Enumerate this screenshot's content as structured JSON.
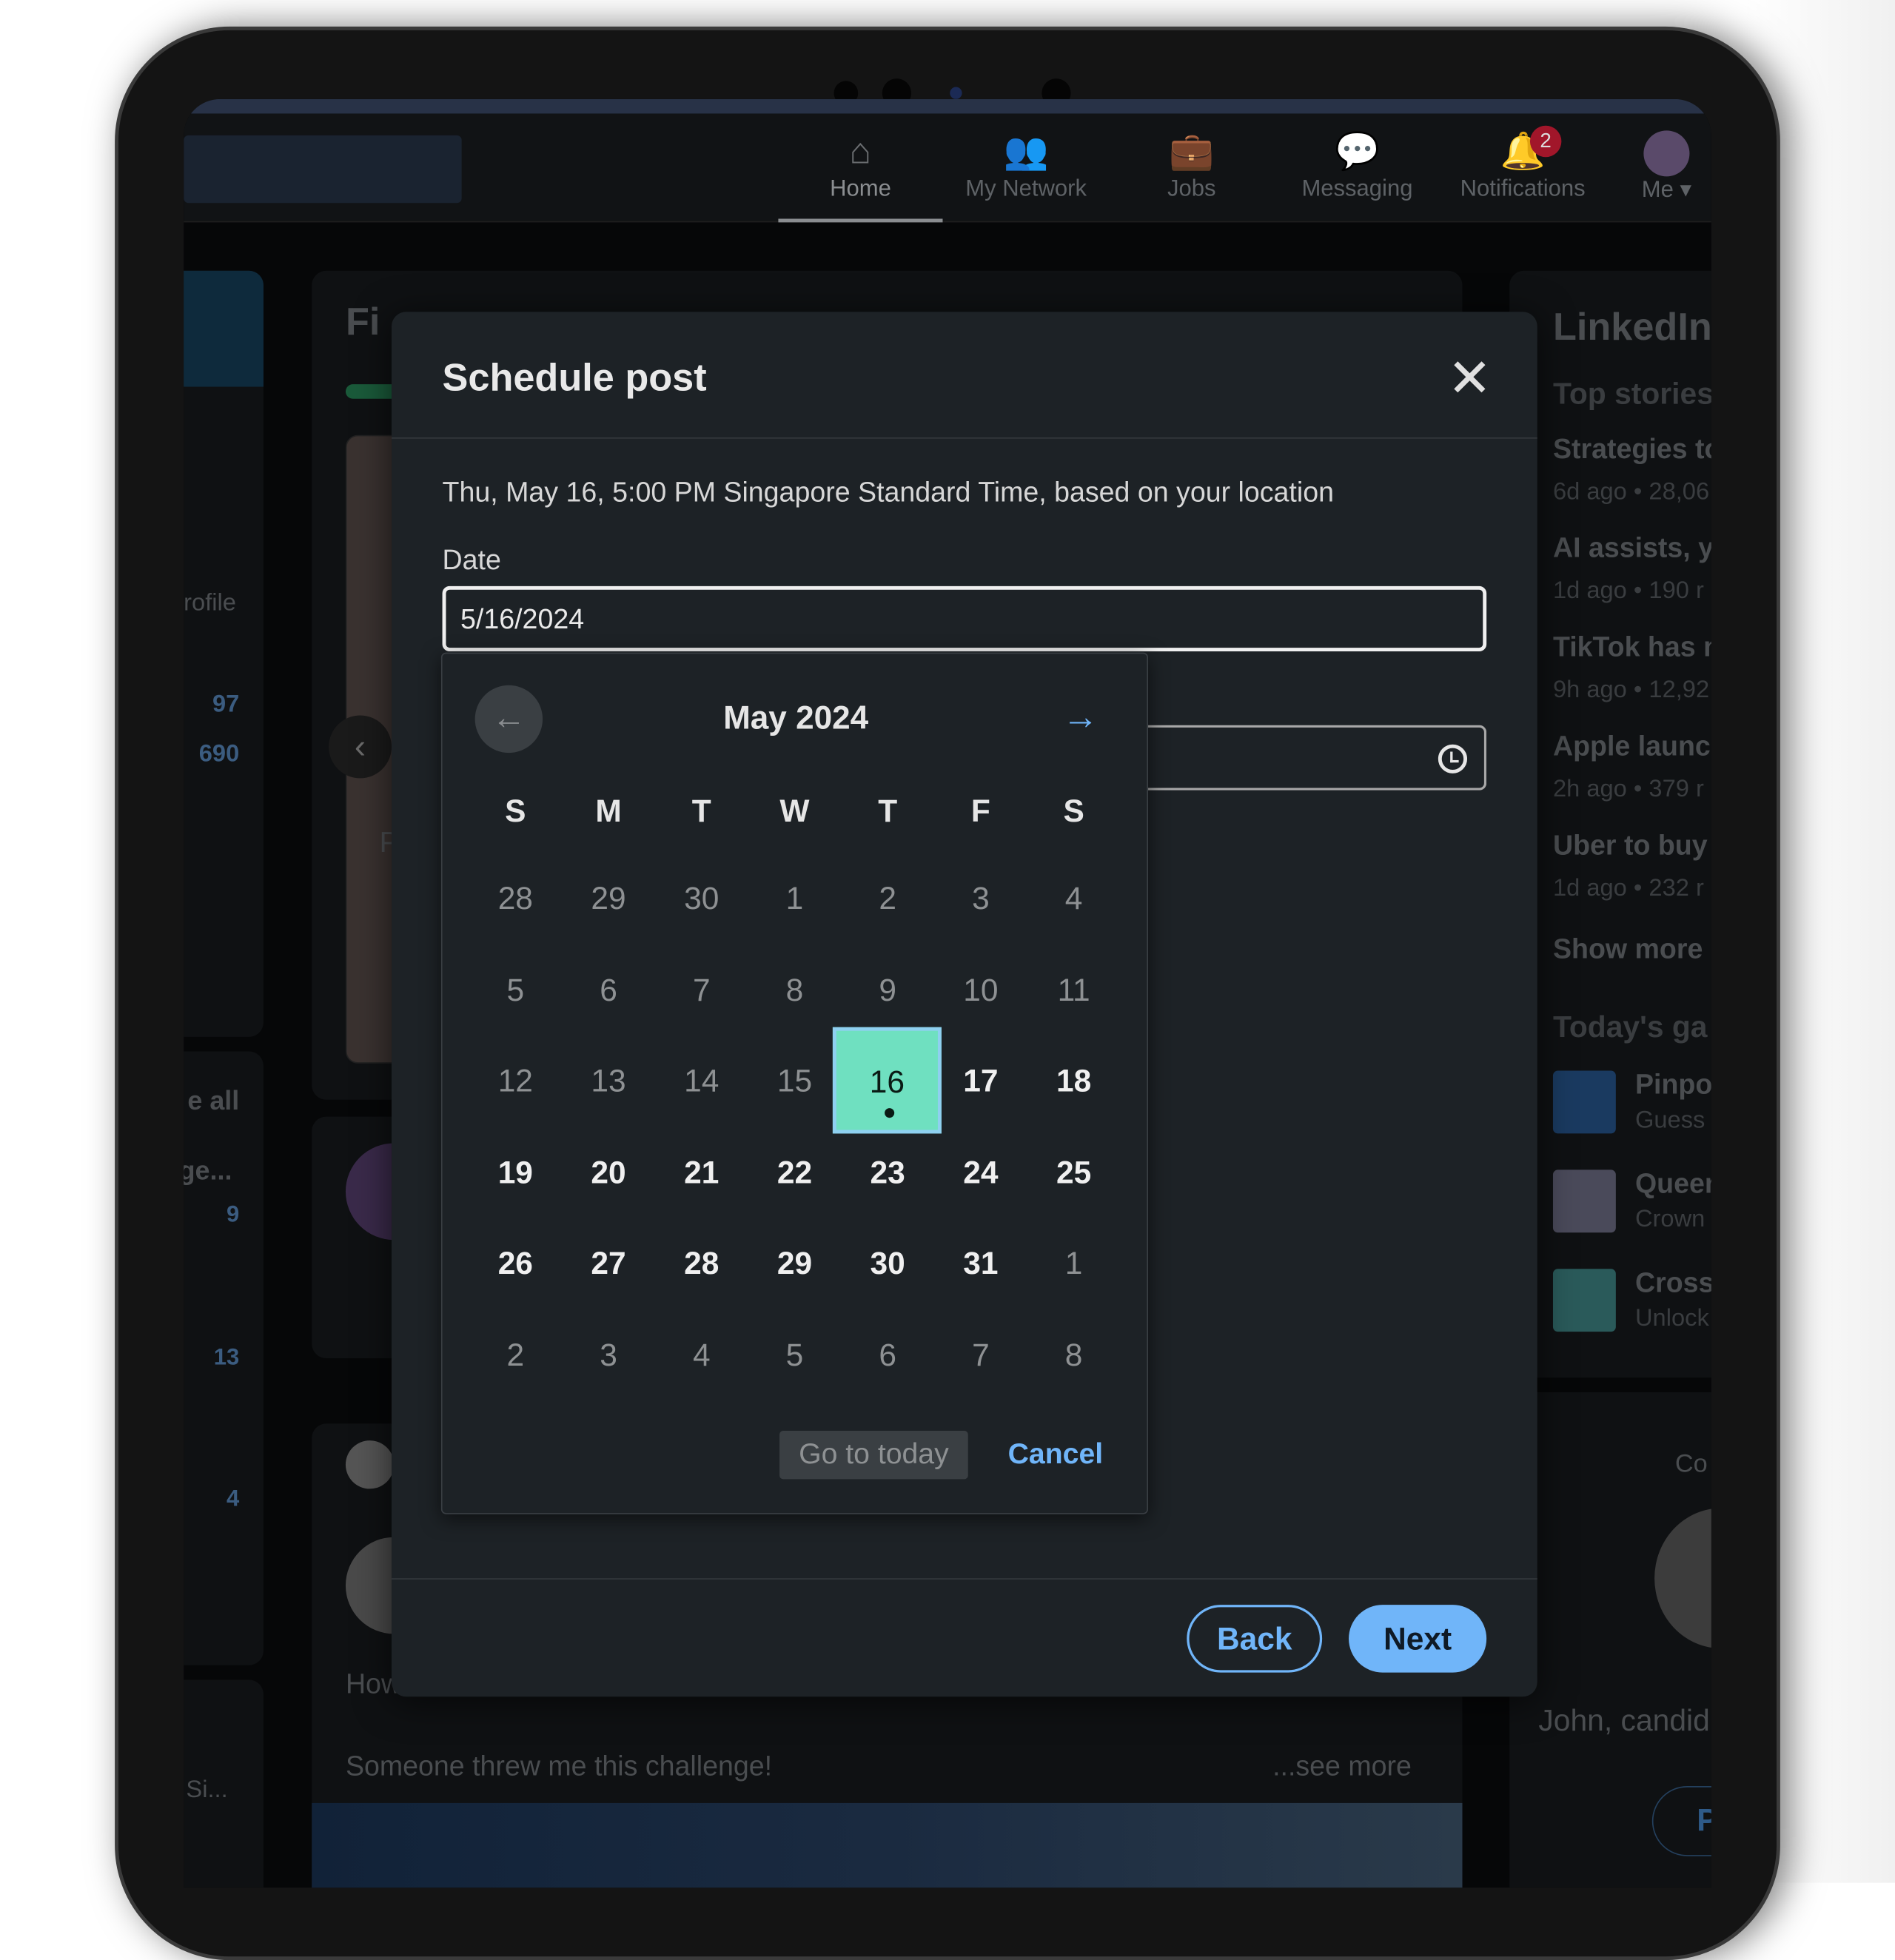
{
  "nav": {
    "items": [
      {
        "label": "Home",
        "icon": "home-icon",
        "active": true
      },
      {
        "label": "My Network",
        "icon": "network-icon"
      },
      {
        "label": "Jobs",
        "icon": "briefcase-icon"
      },
      {
        "label": "Messaging",
        "icon": "chat-icon"
      },
      {
        "label": "Notifications",
        "icon": "bell-icon",
        "badge": "2"
      },
      {
        "label": "Me",
        "icon": "avatar"
      }
    ]
  },
  "left_sidebar": {
    "profile_partial": "rofile",
    "stat1": "97",
    "stat2": "690",
    "see_all": "e all",
    "group_partial": "ge...",
    "count1": "9",
    "count2": "13",
    "count3": "4",
    "bottom_partial": "Si..."
  },
  "feed": {
    "card_title_partial": "Fi",
    "post_text_partial": "How",
    "post_caption": "Someone threw me this challenge!",
    "see_more": "...see more",
    "partial_p": "P"
  },
  "right_sidebar": {
    "title": "LinkedIn",
    "subtitle": "Top stories",
    "stories": [
      {
        "title": "Strategies to",
        "meta": "6d ago • 28,06"
      },
      {
        "title": "AI assists, yo",
        "meta": "1d ago • 190 r"
      },
      {
        "title": "TikTok has m",
        "meta": "9h ago • 12,92"
      },
      {
        "title": "Apple launch",
        "meta": "2h ago • 379 r"
      },
      {
        "title": "Uber to buy",
        "meta": "1d ago • 232 r"
      }
    ],
    "show_more": "Show more",
    "games_title": "Today's ga",
    "games": [
      {
        "title": "Pinpo",
        "sub": "Guess t"
      },
      {
        "title": "Queen",
        "sub": "Crown"
      },
      {
        "title": "Crosse",
        "sub": "Unlock"
      }
    ],
    "ad_label": "Co",
    "ad_text": "John, candid",
    "ad_button": "Pr"
  },
  "modal": {
    "title": "Schedule post",
    "timezone_text": "Thu, May 16, 5:00 PM Singapore Standard Time, based on your location",
    "date_label": "Date",
    "date_value": "5/16/2024",
    "back_label": "Back",
    "next_label": "Next"
  },
  "calendar": {
    "month_label": "May 2024",
    "weekdays": [
      "S",
      "M",
      "T",
      "W",
      "T",
      "F",
      "S"
    ],
    "weeks": [
      [
        {
          "d": "28",
          "s": "outside"
        },
        {
          "d": "29",
          "s": "outside"
        },
        {
          "d": "30",
          "s": "outside"
        },
        {
          "d": "1",
          "s": "past"
        },
        {
          "d": "2",
          "s": "past"
        },
        {
          "d": "3",
          "s": "past"
        },
        {
          "d": "4",
          "s": "past"
        }
      ],
      [
        {
          "d": "5",
          "s": "past"
        },
        {
          "d": "6",
          "s": "past"
        },
        {
          "d": "7",
          "s": "past"
        },
        {
          "d": "8",
          "s": "past"
        },
        {
          "d": "9",
          "s": "past"
        },
        {
          "d": "10",
          "s": "past"
        },
        {
          "d": "11",
          "s": "past"
        }
      ],
      [
        {
          "d": "12",
          "s": "past"
        },
        {
          "d": "13",
          "s": "past"
        },
        {
          "d": "14",
          "s": "past"
        },
        {
          "d": "15",
          "s": "past"
        },
        {
          "d": "16",
          "s": "selected"
        },
        {
          "d": "17",
          "s": "available"
        },
        {
          "d": "18",
          "s": "available"
        }
      ],
      [
        {
          "d": "19",
          "s": "available"
        },
        {
          "d": "20",
          "s": "available"
        },
        {
          "d": "21",
          "s": "available"
        },
        {
          "d": "22",
          "s": "available"
        },
        {
          "d": "23",
          "s": "available"
        },
        {
          "d": "24",
          "s": "available"
        },
        {
          "d": "25",
          "s": "available"
        }
      ],
      [
        {
          "d": "26",
          "s": "available"
        },
        {
          "d": "27",
          "s": "available"
        },
        {
          "d": "28",
          "s": "available"
        },
        {
          "d": "29",
          "s": "available"
        },
        {
          "d": "30",
          "s": "available"
        },
        {
          "d": "31",
          "s": "available"
        },
        {
          "d": "1",
          "s": "outside"
        }
      ],
      [
        {
          "d": "2",
          "s": "outside"
        },
        {
          "d": "3",
          "s": "outside"
        },
        {
          "d": "4",
          "s": "outside"
        },
        {
          "d": "5",
          "s": "outside"
        },
        {
          "d": "6",
          "s": "outside"
        },
        {
          "d": "7",
          "s": "outside"
        },
        {
          "d": "8",
          "s": "outside"
        }
      ]
    ],
    "go_to_today": "Go to today",
    "cancel": "Cancel"
  },
  "colors": {
    "accent": "#70b5f9",
    "selected_day": "#6fe0c0",
    "modal_bg": "#1d2226",
    "badge": "#a1162a"
  }
}
